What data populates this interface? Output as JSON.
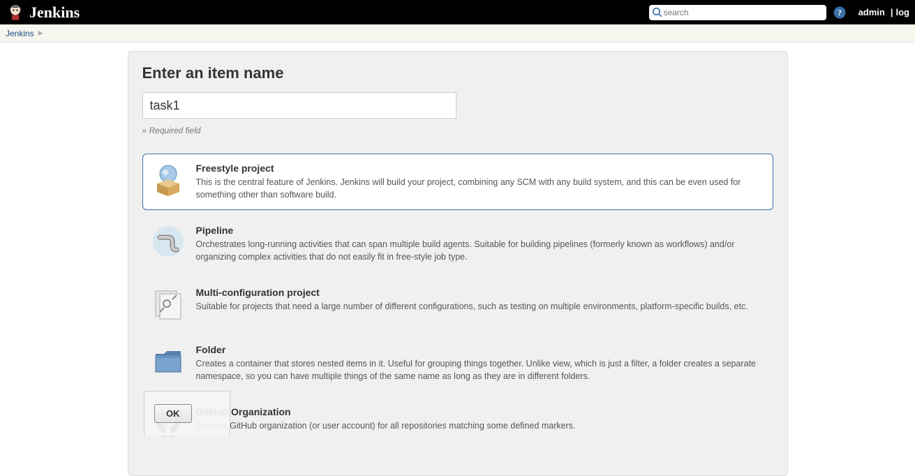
{
  "header": {
    "logo_text": "Jenkins",
    "search_placeholder": "search",
    "user": "admin",
    "divider": "|",
    "logout": "log"
  },
  "breadcrumb": {
    "root": "Jenkins"
  },
  "form": {
    "title": "Enter an item name",
    "name_value": "task1",
    "required_note": "» Required field",
    "ok_label": "OK"
  },
  "items": [
    {
      "title": "Freestyle project",
      "desc": "This is the central feature of Jenkins. Jenkins will build your project, combining any SCM with any build system, and this can be even used for something other than software build.",
      "selected": true
    },
    {
      "title": "Pipeline",
      "desc": "Orchestrates long-running activities that can span multiple build agents. Suitable for building pipelines (formerly known as workflows) and/or organizing complex activities that do not easily fit in free-style job type.",
      "selected": false
    },
    {
      "title": "Multi-configuration project",
      "desc": "Suitable for projects that need a large number of different configurations, such as testing on multiple environments, platform-specific builds, etc.",
      "selected": false
    },
    {
      "title": "Folder",
      "desc": "Creates a container that stores nested items in it. Useful for grouping things together. Unlike view, which is just a filter, a folder creates a separate namespace, so you can have multiple things of the same name as long as they are in different folders.",
      "selected": false
    },
    {
      "title": "GitHub Organization",
      "desc": "Scans a GitHub organization (or user account) for all repositories matching some defined markers.",
      "selected": false
    }
  ]
}
